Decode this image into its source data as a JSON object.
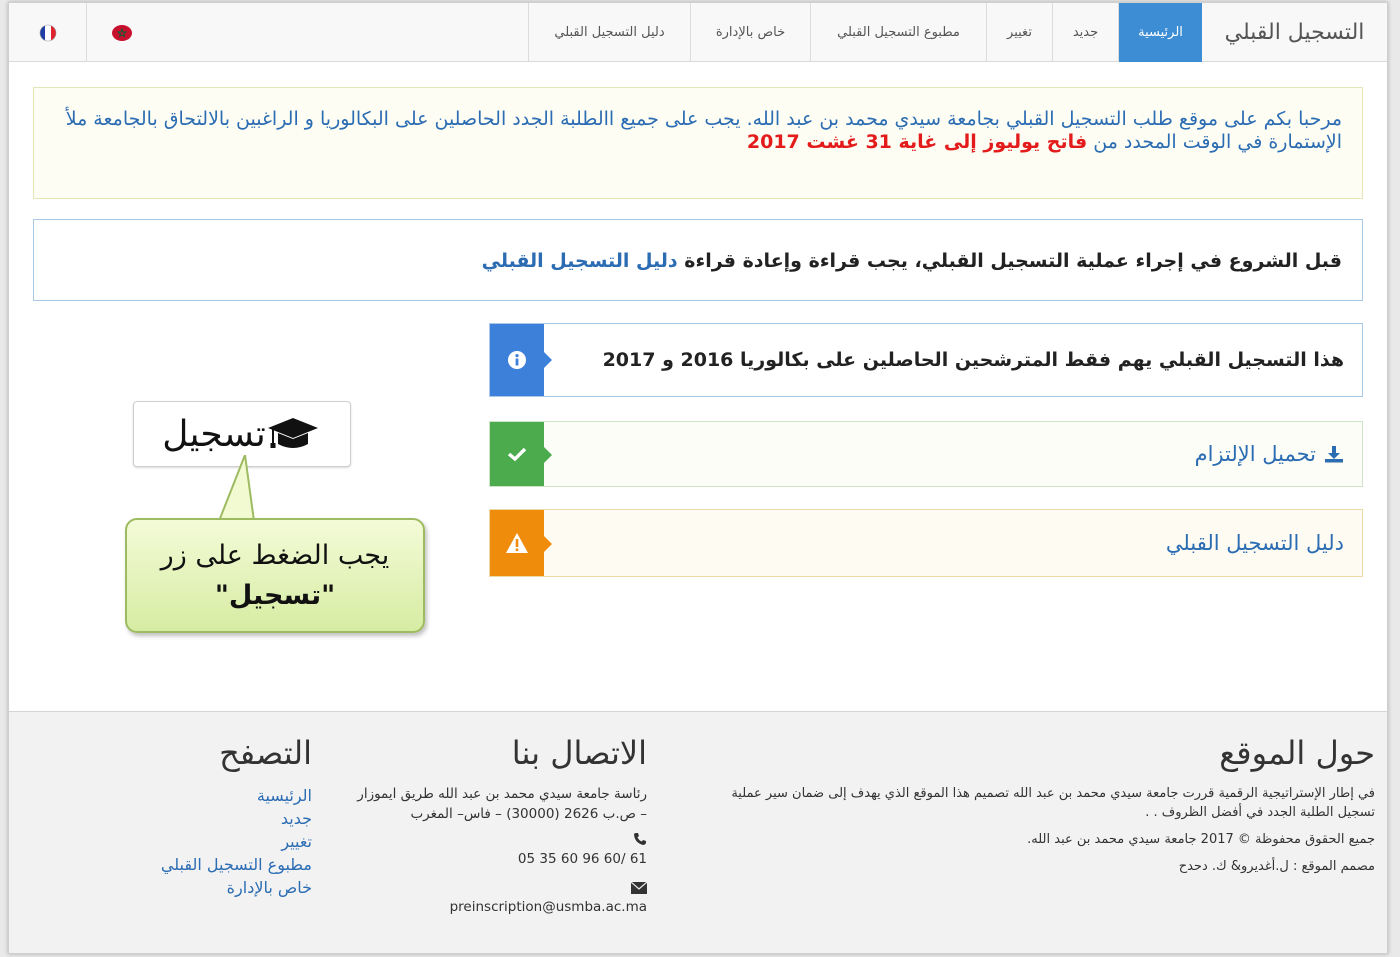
{
  "navbar": {
    "brand": "التسجيل القبلي",
    "items": [
      "الرئيسية",
      "جديد",
      "تغيير",
      "مطبوع التسجيل القبلي",
      "خاص بالإدارة",
      "دليل التسجيل القبلي"
    ],
    "active_index": 0
  },
  "welcome": {
    "text": "مرحبا بكم على موقع طلب التسجيل القبلي بجامعة سيدي محمد بن عبد الله. يجب على جميع االطلبة الجدد الحاصلين على البكالوريا و الراغبين بالالتحاق بالجامعة ملأ الإستمارة في الوقت المحدد من ",
    "highlight": "فاتح يوليوز إلى غاية 31 غشت 2017"
  },
  "guide_notice": {
    "text": "قبل الشروع في إجراء عملية التسجيل القبلي، يجب قراءة وإعادة قراءة ",
    "link": "دليل التسجيل القبلي"
  },
  "boxes": {
    "info": "هذا التسجيل القبلي يهم فقط المترشحين الحاصلين على بكالوريا 2016 و 2017",
    "download": "تحميل الإلتزام",
    "guide": "دليل التسجيل القبلي"
  },
  "register_button": "تسجيل",
  "callout": {
    "line1": "يجب الضغط على زر",
    "line2": "\"تسجيل\""
  },
  "footer": {
    "about": {
      "title": "حول الموقع",
      "text": "في إطار الإستراتيجية الرقمية قررت جامعة سيدي محمد بن عبد الله تصميم هذا الموقع الذي يهدف إلى ضمان سير عملية تسجيل الطلبة الجدد في أفضل الظروف . .",
      "copyright": "جميع الحقوق محفوظة © 2017 جامعة سيدي محمد بن عبد الله.",
      "designer": "مصمم الموقع : ل.أغديرو& ك. دحدح"
    },
    "contact": {
      "title": "الاتصال بنا",
      "address": "رئاسة جامعة سيدي محمد بن عبد الله طريق ايموزار – ص.ب 2626 (30000) – فاس– المغرب",
      "phone": "05 35 60 96 60/ 61",
      "email": "preinscription@usmba.ac.ma"
    },
    "browse": {
      "title": "التصفح",
      "links": [
        "الرئيسية",
        "جديد",
        "تغيير",
        "مطبوع التسجيل القبلي",
        "خاص بالإدارة"
      ]
    }
  },
  "colors": {
    "accent": "#3c8dd4",
    "link": "#2b6cb3",
    "highlight": "#e31b1b",
    "info": "#3d80d9",
    "success": "#4cab4c",
    "warning": "#f08c0c"
  },
  "icons": [
    "france-flag-icon",
    "morocco-flag-icon",
    "info-icon",
    "check-icon",
    "warning-icon",
    "download-icon",
    "graduation-cap-icon",
    "phone-icon",
    "envelope-icon"
  ]
}
